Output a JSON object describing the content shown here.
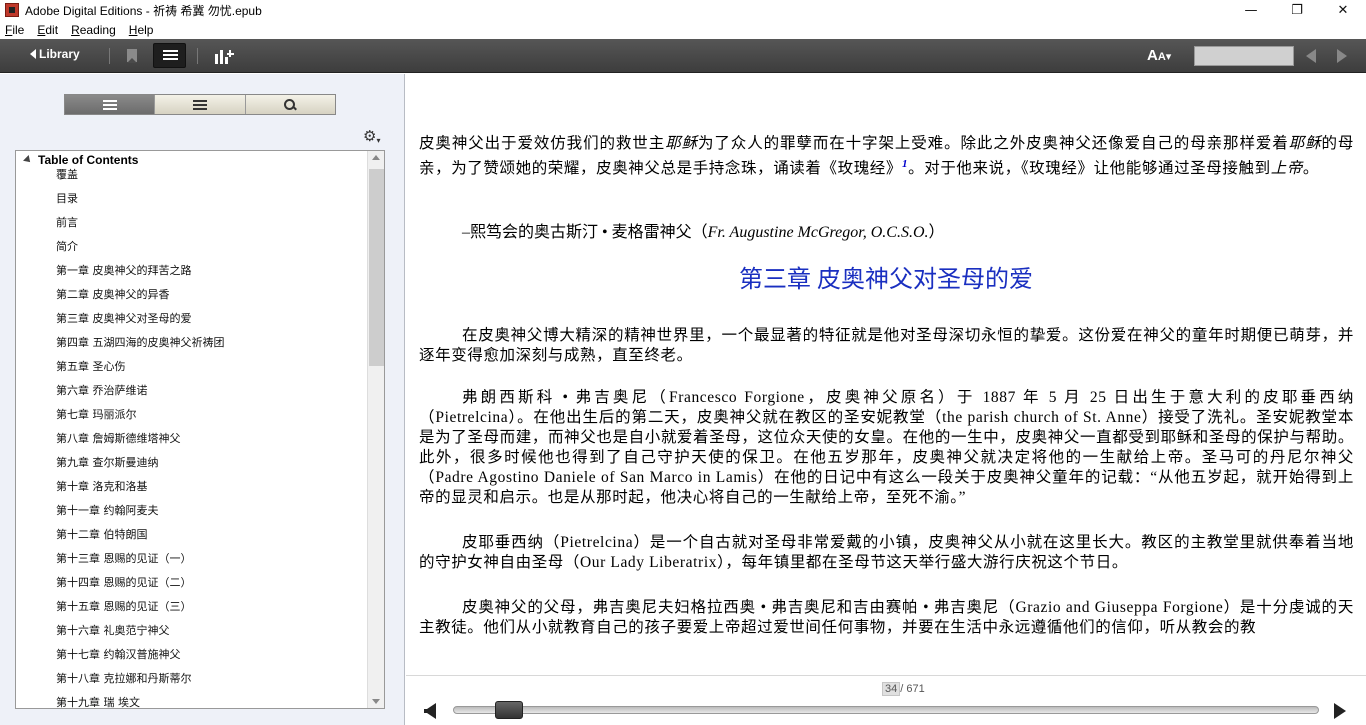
{
  "window": {
    "title": "Adobe Digital Editions - 祈祷 希冀 勿忧.epub",
    "minimize": "—",
    "maximize": "❐",
    "close": "✕"
  },
  "menu": [
    "File",
    "Edit",
    "Reading",
    "Help"
  ],
  "toolbar": {
    "library_label": "Library",
    "font_size_label": "A",
    "font_size_small": "A",
    "page_input_value": ""
  },
  "sidebar": {
    "toc_title": "Table of Contents",
    "toc_items": [
      "覆盖",
      "目录",
      "前言",
      "简介",
      "第一章 皮奥神父的拜苦之路",
      "第二章 皮奥神父的异香",
      "第三章 皮奥神父对圣母的爱",
      "第四章 五湖四海的皮奥神父祈祷团",
      "第五章 圣心伤",
      "第六章 乔治萨维诺",
      "第七章 玛丽派尔",
      "第八章 詹姆斯德维塔神父",
      "第九章 查尔斯曼迪纳",
      "第十章 洛克和洛基",
      "第十一章 约翰阿麦夫",
      "第十二章 伯特朗国",
      "第十三章 恩赐的见证（一）",
      "第十四章 恩赐的见证（二）",
      "第十五章 恩赐的见证（三）",
      "第十六章 礼奥范宁神父",
      "第十七章 约翰汉普施神父",
      "第十八章 克拉娜和丹斯蒂尔",
      "第十九章 瑞 埃文"
    ]
  },
  "content": {
    "p1_a": "皮奥神父出于爱效仿我们的救世主",
    "p1_b": "耶稣",
    "p1_c": "为了众人的罪孽而在十字架上受难。除此之外皮奥神父还像爱自己的母亲那样爱着",
    "p1_d": "耶稣",
    "p1_e": "的母亲，为了赞颂她的荣耀，皮奥神父总是手持念珠，诵读着《玫瑰经》",
    "p1_fn": "1",
    "p1_f": "。对于他来说，《玫瑰经》让他能够通过圣母接触到",
    "p1_g": "上帝",
    "p1_h": "。",
    "sig_a": "–熙笃会的奥古斯汀 • 麦格雷神父（",
    "sig_b": "Fr. Augustine McGregor, O.C.S.O.",
    "sig_c": "）",
    "chapter_title": "第三章 皮奥神父对圣母的爱",
    "p2": "在皮奥神父博大精深的精神世界里，一个最显著的特征就是他对圣母深切永恒的挚爱。这份爱在神父的童年时期便已萌芽，并逐年变得愈加深刻与成熟，直至终老。",
    "p3": "弗朗西斯科 • 弗吉奥尼（Francesco Forgione，皮奥神父原名）于 1887 年 5 月 25 日出生于意大利的皮耶垂西纳（Pietrelcina）。在他出生后的第二天，皮奥神父就在教区的圣安妮教堂（the parish church of St. Anne）接受了洗礼。圣安妮教堂本是为了圣母而建，而神父也是自小就爱着圣母，这位众天使的女皇。在他的一生中，皮奥神父一直都受到耶稣和圣母的保护与帮助。此外，很多时候他也得到了自己守护天使的保卫。在他五岁那年，皮奥神父就决定将他的一生献给上帝。圣马可的丹尼尔神父（Padre Agostino Daniele of San Marco in Lamis）在他的日记中有这么一段关于皮奥神父童年的记载：“从他五岁起，就开始得到上帝的显灵和启示。也是从那时起，他决心将自己的一生献给上帝，至死不渝。”",
    "p4": "皮耶垂西纳（Pietrelcina）是一个自古就对圣母非常爱戴的小镇，皮奥神父从小就在这里长大。教区的主教堂里就供奉着当地的守护女神自由圣母（Our Lady Liberatrix），每年镇里都在圣母节这天举行盛大游行庆祝这个节日。",
    "p5": "皮奥神父的父母，弗吉奥尼夫妇格拉西奥 • 弗吉奥尼和吉由赛帕 • 弗吉奥尼（Grazio and Giuseppa Forgione）是十分虔诚的天主教徒。他们从小就教育自己的孩子要爱上帝超过爱世间任何事物，并要在生活中永远遵循他们的信仰，听从教会的教"
  },
  "navigation": {
    "current_page": "34",
    "page_separator": "/",
    "total_pages": "671",
    "progress": 0.049
  }
}
